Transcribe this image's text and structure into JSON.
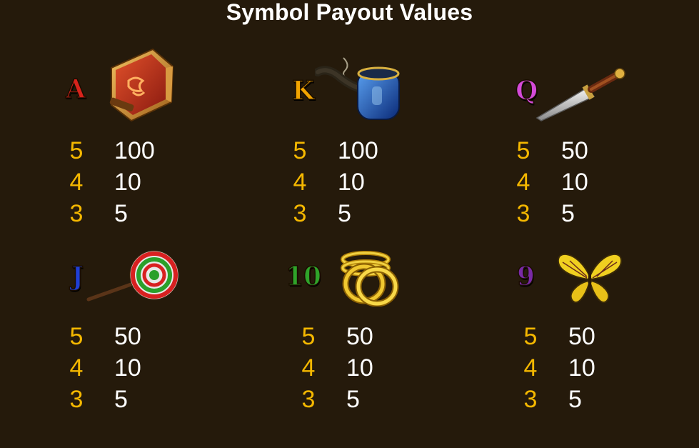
{
  "title": "Symbol Payout Values",
  "symbols": [
    {
      "letter": "A",
      "letter_color": "#d8231c",
      "icon": "book-icon",
      "payouts": [
        {
          "count": "5",
          "value": "100"
        },
        {
          "count": "4",
          "value": "10"
        },
        {
          "count": "3",
          "value": "5"
        }
      ]
    },
    {
      "letter": "K",
      "letter_color": "#f2a400",
      "icon": "pipe-icon",
      "payouts": [
        {
          "count": "5",
          "value": "100"
        },
        {
          "count": "4",
          "value": "10"
        },
        {
          "count": "3",
          "value": "5"
        }
      ]
    },
    {
      "letter": "Q",
      "letter_color": "#d34ad8",
      "icon": "dagger-icon",
      "payouts": [
        {
          "count": "5",
          "value": "50"
        },
        {
          "count": "4",
          "value": "10"
        },
        {
          "count": "3",
          "value": "5"
        }
      ]
    },
    {
      "letter": "J",
      "letter_color": "#1f3fd6",
      "icon": "lollipop-icon",
      "payouts": [
        {
          "count": "5",
          "value": "50"
        },
        {
          "count": "4",
          "value": "10"
        },
        {
          "count": "3",
          "value": "5"
        }
      ]
    },
    {
      "letter": "10",
      "letter_color": "#2fa32a",
      "icon": "gold-rings-icon",
      "payouts": [
        {
          "count": "5",
          "value": "50"
        },
        {
          "count": "4",
          "value": "10"
        },
        {
          "count": "3",
          "value": "5"
        }
      ]
    },
    {
      "letter": "9",
      "letter_color": "#7a2aa6",
      "icon": "butterfly-icon",
      "payouts": [
        {
          "count": "5",
          "value": "50"
        },
        {
          "count": "4",
          "value": "10"
        },
        {
          "count": "3",
          "value": "5"
        }
      ]
    }
  ]
}
